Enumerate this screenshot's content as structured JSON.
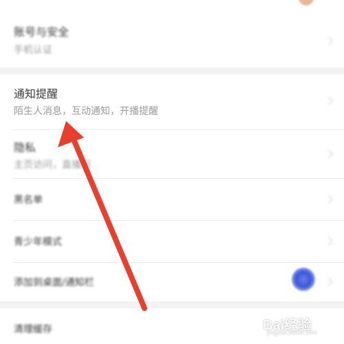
{
  "settings": {
    "rows": [
      {
        "title": "账号与安全",
        "subtitle": "手机认证"
      },
      {
        "title": "通知提醒",
        "subtitle": "陌生人消息，互动通知，开播提醒"
      },
      {
        "title": "隐私",
        "subtitle": "主页访问，直播间"
      },
      {
        "title": "黑名单",
        "subtitle": ""
      },
      {
        "title": "青少年模式",
        "subtitle": ""
      },
      {
        "title": "添加到桌面/通知栏",
        "subtitle": ""
      },
      {
        "title": "清理缓存",
        "subtitle": ""
      }
    ]
  },
  "watermark": {
    "brand": "Bai经验",
    "url": "jingyan.baidu.com"
  },
  "colors": {
    "arrow": "#e8402e",
    "background": "#f3f3f3",
    "card": "#ffffff"
  }
}
